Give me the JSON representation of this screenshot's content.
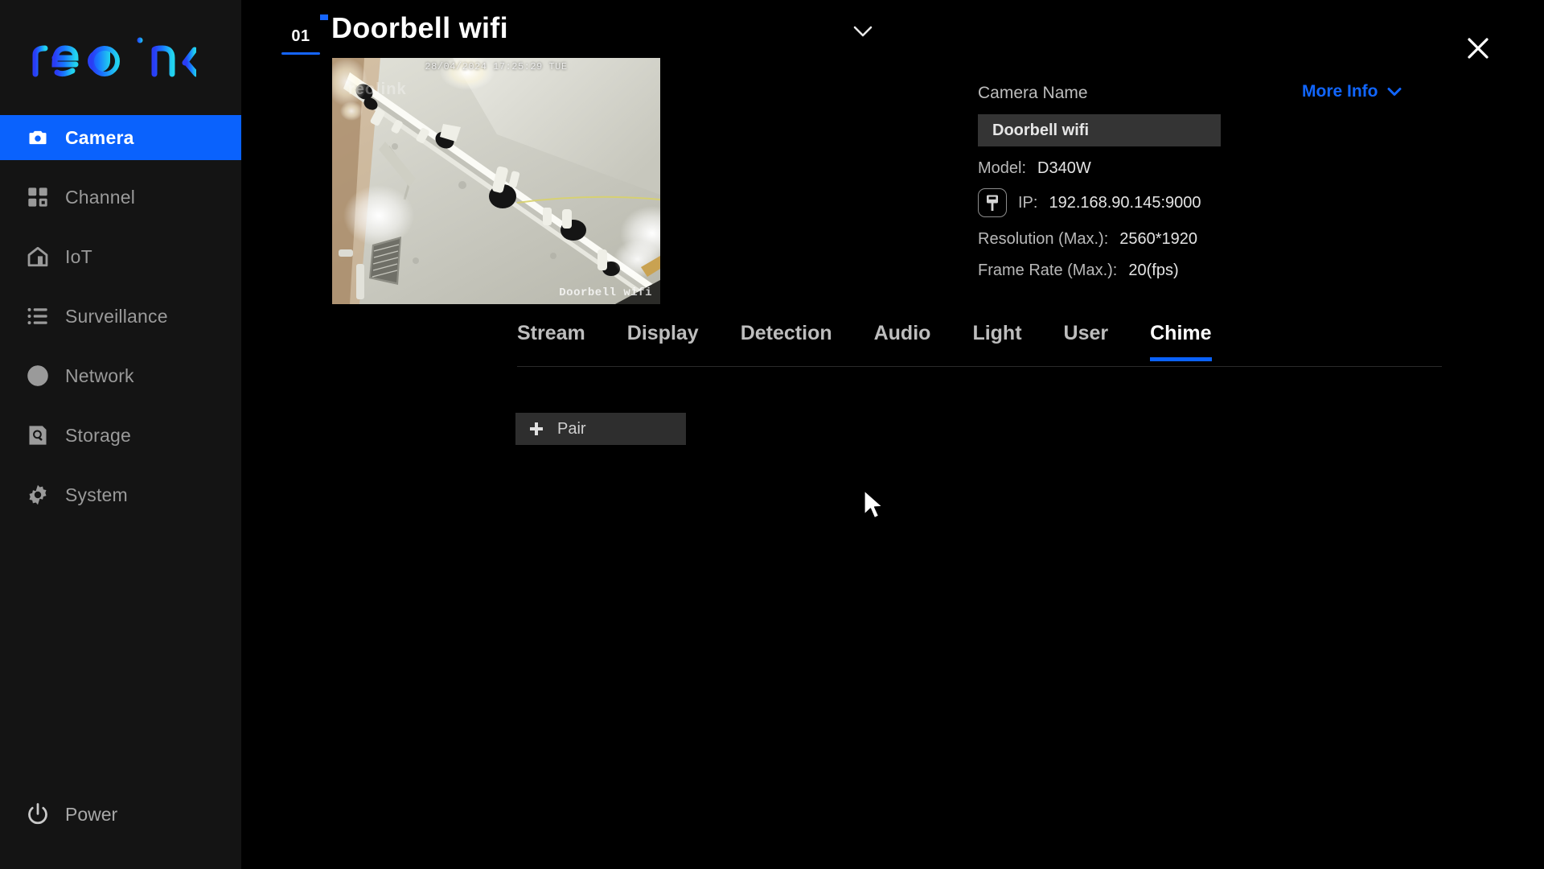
{
  "sidebar": {
    "logo_text": "reolink",
    "items": [
      {
        "label": "Camera",
        "icon": "camera-icon",
        "active": true
      },
      {
        "label": "Channel",
        "icon": "grid-icon",
        "active": false
      },
      {
        "label": "IoT",
        "icon": "home-icon",
        "active": false
      },
      {
        "label": "Surveillance",
        "icon": "list-icon",
        "active": false
      },
      {
        "label": "Network",
        "icon": "globe-icon",
        "active": false
      },
      {
        "label": "Storage",
        "icon": "hard-drive-icon",
        "active": false
      },
      {
        "label": "System",
        "icon": "gear-icon",
        "active": false
      }
    ],
    "power_label": "Power",
    "power_icon": "power-icon"
  },
  "header": {
    "channel_number": "01",
    "camera_title": "Doorbell wifi",
    "caret_icon": "chevron-down-icon",
    "close_icon": "close-icon"
  },
  "preview": {
    "timestamp": "28/04/2024 17:25:29 TUE",
    "watermark_top_left": "reolink",
    "watermark_bottom_right": "Doorbell wifi"
  },
  "info": {
    "camera_name_label": "Camera Name",
    "camera_name_value": "Doorbell wifi",
    "more_info_label": "More Info",
    "more_info_icon": "chevron-down-icon",
    "ip_icon": "ethernet-plug-icon",
    "specs": [
      {
        "key": "Model:",
        "value": "D340W"
      },
      {
        "key": "IP:",
        "value": "192.168.90.145:9000"
      },
      {
        "key": "Resolution (Max.):",
        "value": "2560*1920"
      },
      {
        "key": "Frame Rate (Max.):",
        "value": "20(fps)"
      }
    ]
  },
  "tabs": [
    {
      "label": "Stream",
      "active": false
    },
    {
      "label": "Display",
      "active": false
    },
    {
      "label": "Detection",
      "active": false
    },
    {
      "label": "Audio",
      "active": false
    },
    {
      "label": "Light",
      "active": false
    },
    {
      "label": "User",
      "active": false
    },
    {
      "label": "Chime",
      "active": true
    }
  ],
  "content": {
    "pair_label": "Pair",
    "pair_icon": "plus-icon"
  },
  "colors": {
    "accent_blue": "#0a62fd",
    "link_blue": "#1166ff",
    "sidebar_bg": "#141414",
    "main_bg": "#000000",
    "text_muted": "#9a9a9a"
  }
}
